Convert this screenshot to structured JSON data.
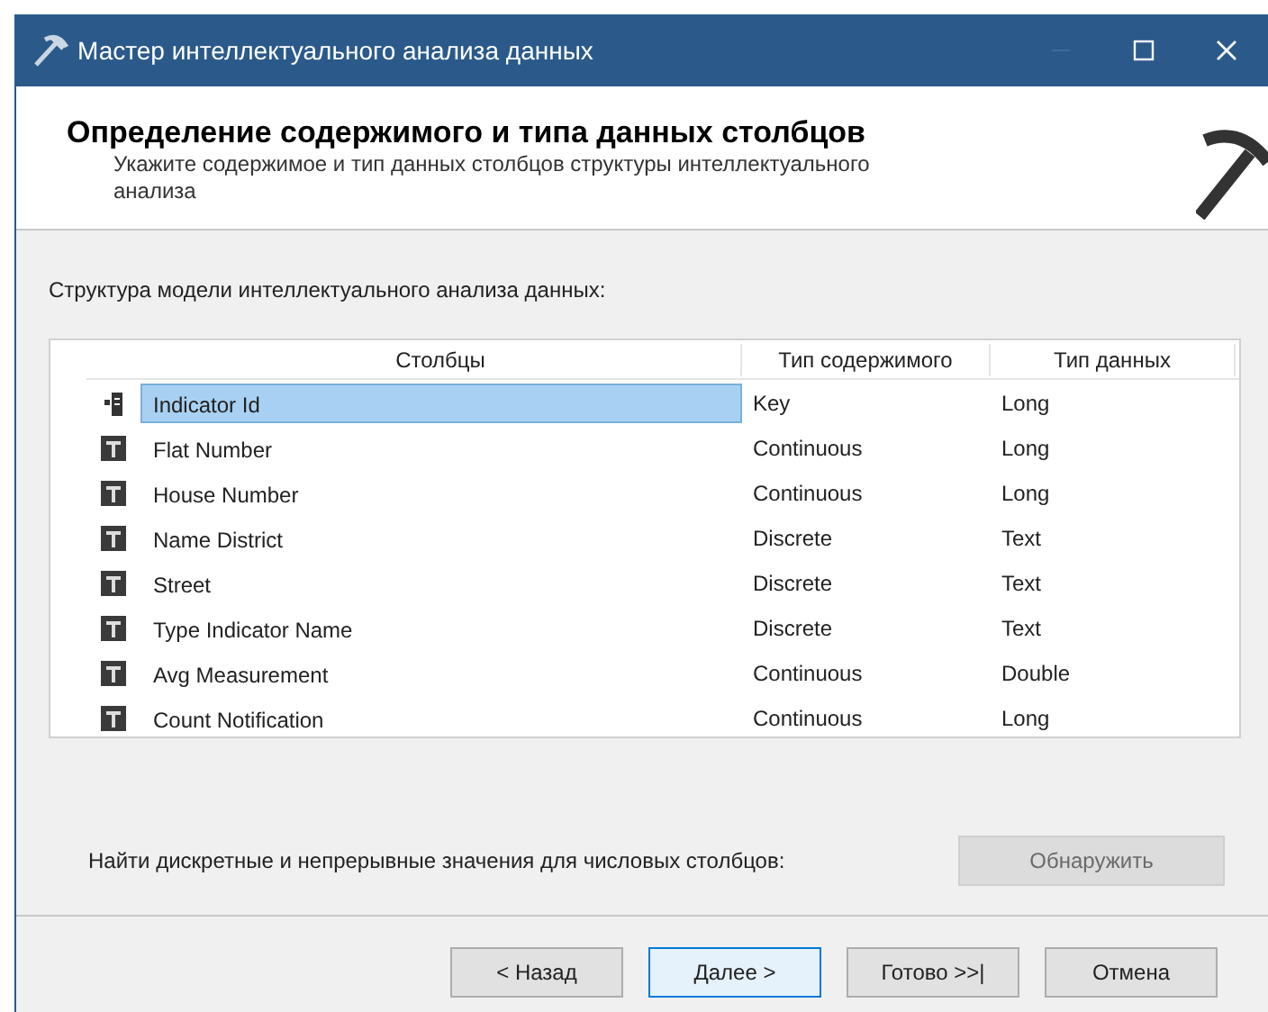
{
  "window": {
    "title": "Мастер интеллектуального анализа данных"
  },
  "header": {
    "title": "Определение содержимого и типа данных столбцов",
    "subtitle": "Укажите содержимое и тип данных столбцов структуры интеллектуального анализа"
  },
  "structure_label": "Структура модели интеллектуального анализа данных:",
  "table": {
    "columns": [
      "Столбцы",
      "Тип содержимого",
      "Тип данных"
    ],
    "rows": [
      {
        "kind": "key",
        "name": "Indicator Id",
        "content_type": "Key",
        "data_type": "Long",
        "selected": true
      },
      {
        "kind": "column",
        "name": "Flat Number",
        "content_type": "Continuous",
        "data_type": "Long",
        "selected": false
      },
      {
        "kind": "column",
        "name": "House Number",
        "content_type": "Continuous",
        "data_type": "Long",
        "selected": false
      },
      {
        "kind": "column",
        "name": "Name District",
        "content_type": "Discrete",
        "data_type": "Text",
        "selected": false
      },
      {
        "kind": "column",
        "name": "Street",
        "content_type": "Discrete",
        "data_type": "Text",
        "selected": false
      },
      {
        "kind": "column",
        "name": "Type Indicator Name",
        "content_type": "Discrete",
        "data_type": "Text",
        "selected": false
      },
      {
        "kind": "column",
        "name": "Avg Measurement",
        "content_type": "Continuous",
        "data_type": "Double",
        "selected": false
      },
      {
        "kind": "column",
        "name": "Count Notification",
        "content_type": "Continuous",
        "data_type": "Long",
        "selected": false
      }
    ]
  },
  "detect": {
    "label": "Найти дискретные и непрерывные значения для числовых столбцов:",
    "button": "Обнаружить",
    "disabled": true
  },
  "buttons": [
    {
      "label": "< Назад",
      "default": false
    },
    {
      "label": "Далее >",
      "default": true
    },
    {
      "label": "Готово >>|",
      "default": false
    },
    {
      "label": "Отмена",
      "default": false
    }
  ]
}
